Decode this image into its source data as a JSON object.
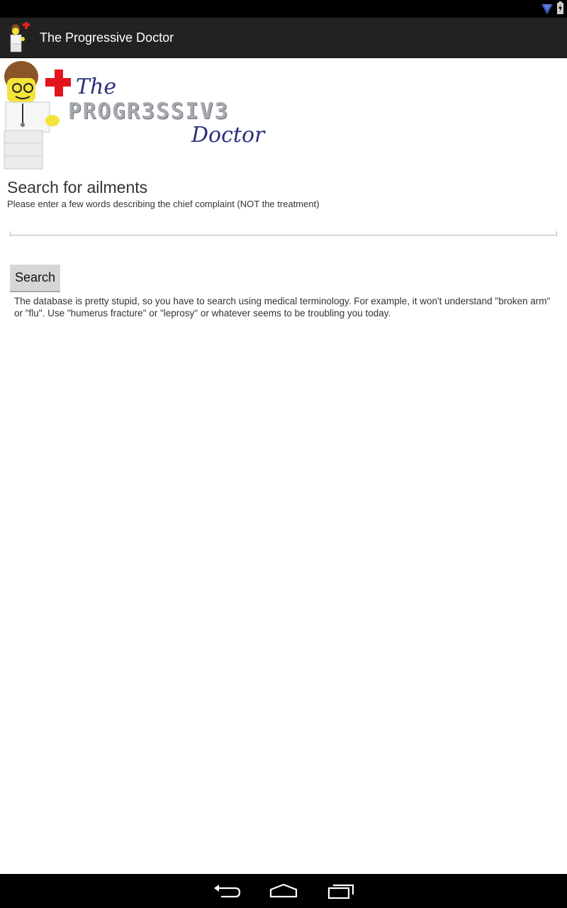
{
  "status_bar": {
    "icons": [
      "wifi-icon",
      "battery-charging-icon"
    ]
  },
  "action_bar": {
    "title": "The Progressive Doctor",
    "icon": "doctor-lego-icon"
  },
  "logo": {
    "line1": "The",
    "line2": "PROGR3SSIV3",
    "line3": "Doctor"
  },
  "search": {
    "heading": "Search for ailments",
    "subheading": "Please enter a few words describing the chief complaint (NOT the treatment)",
    "input_value": "",
    "input_placeholder": "",
    "button_label": "Search",
    "help_text": "The database is pretty stupid, so you have to search using medical terminology. For example, it won't understand \"broken arm\" or \"flu\". Use \"humerus fracture\" or \"leprosy\" or whatever seems to be troubling you today."
  },
  "nav_bar": {
    "icons": [
      "back-icon",
      "home-icon",
      "recent-apps-icon"
    ]
  },
  "colors": {
    "status_bar": "#000000",
    "action_bar": "#222222",
    "logo_blue": "#2b2f7a",
    "logo_gray": "#a5a8ad",
    "button_bg": "#d6d6d6",
    "text": "#333333"
  }
}
